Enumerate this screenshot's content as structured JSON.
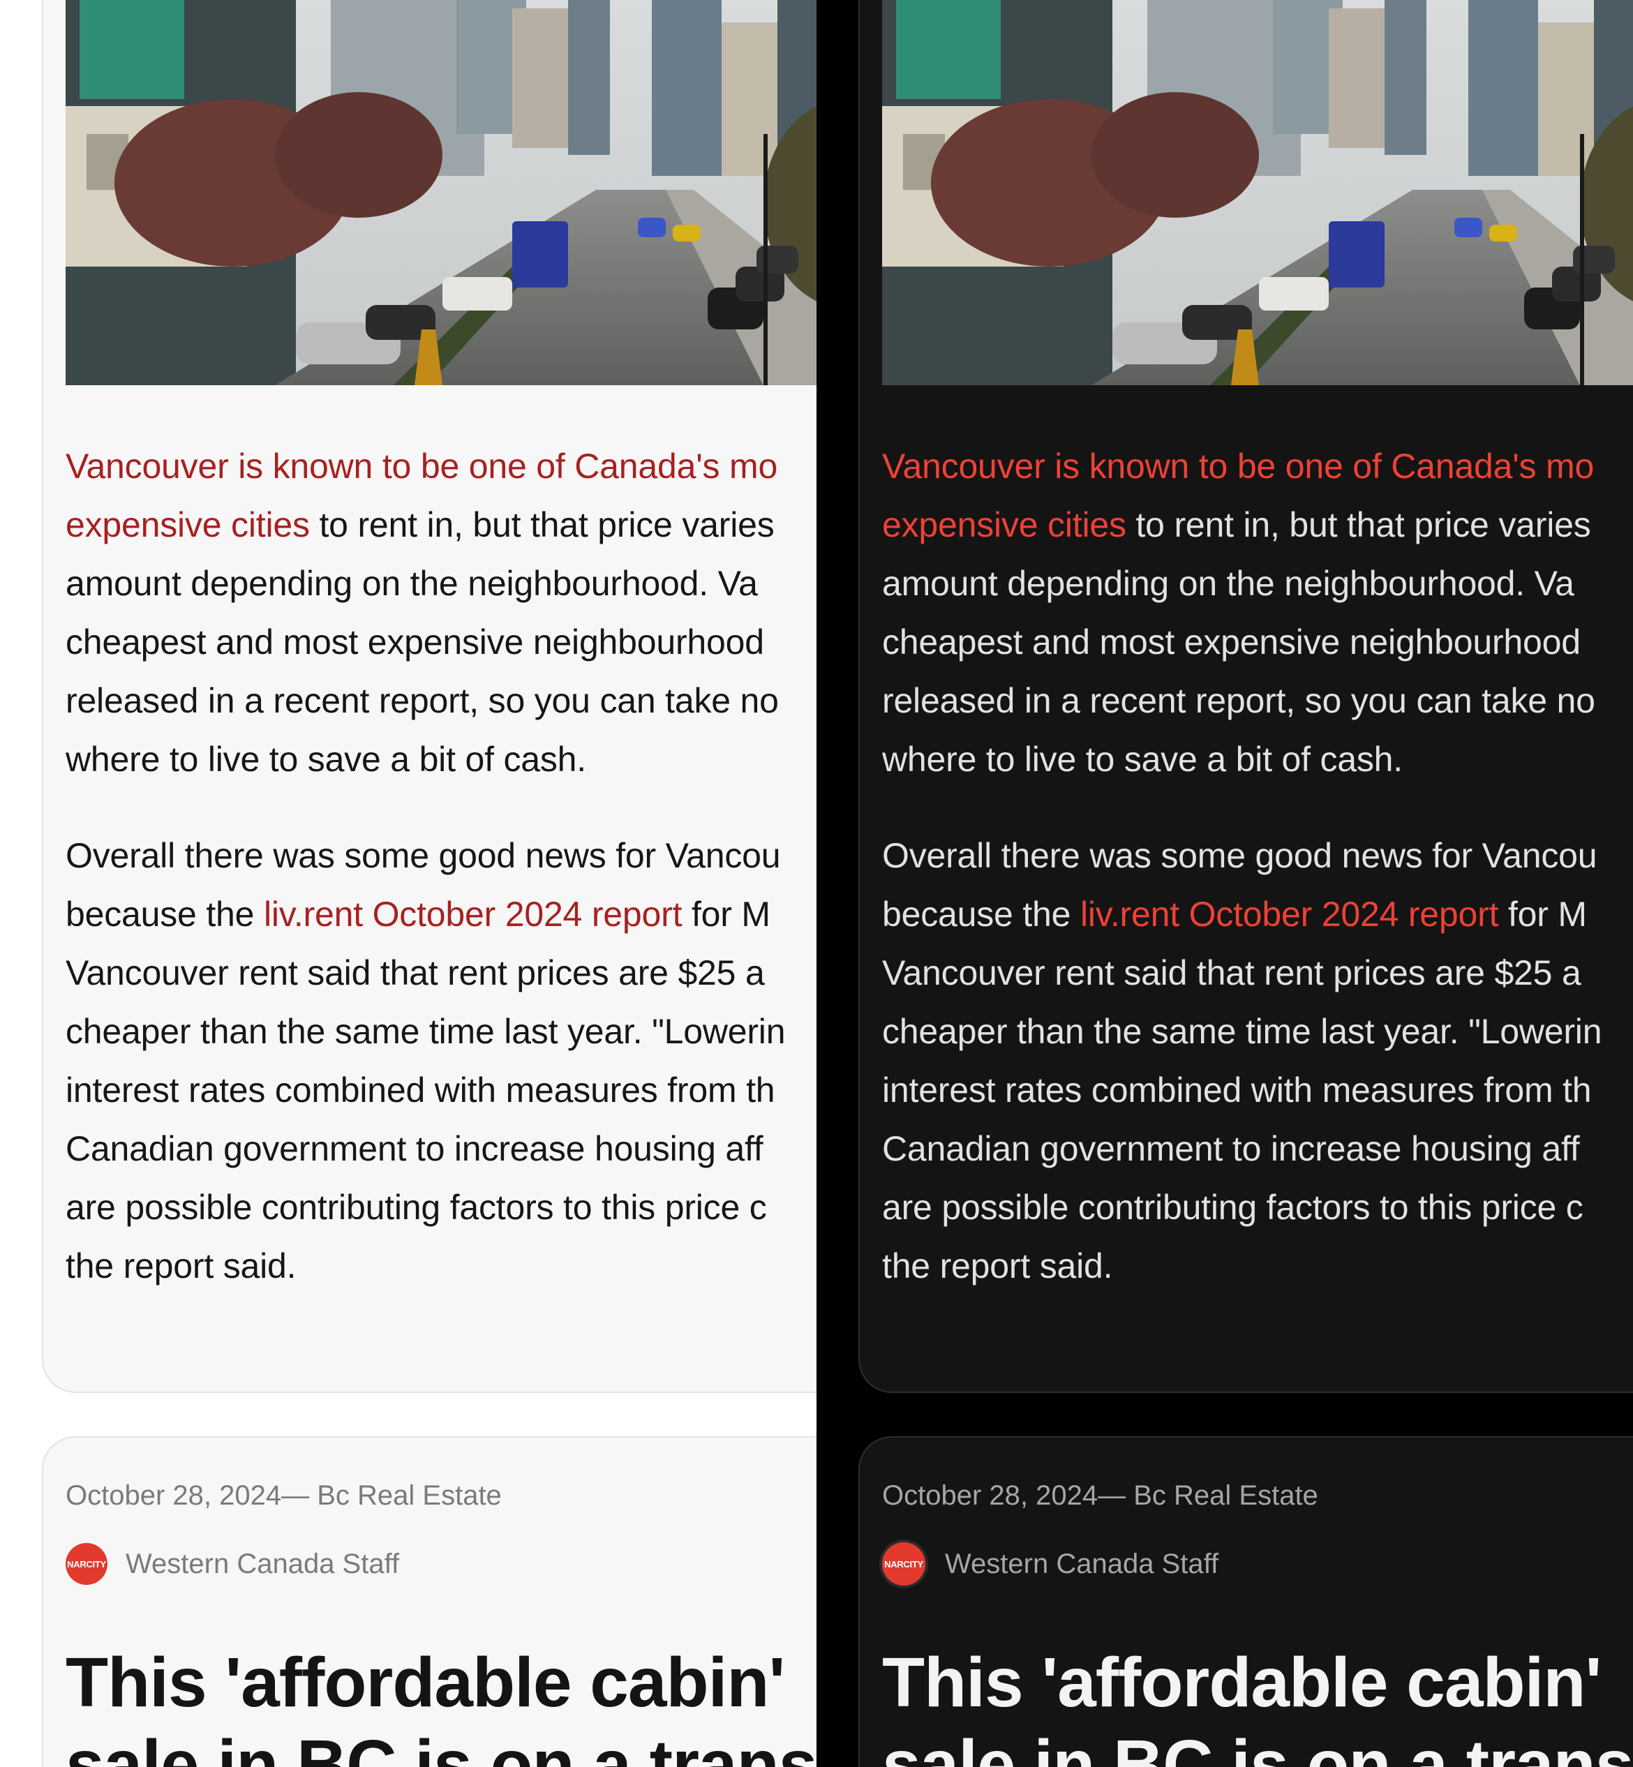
{
  "article_card": {
    "paragraph1": {
      "link_text_line1": "Vancouver is known to be one of Canada's mo",
      "link_text_line2": "expensive cities",
      "line2_rest": " to rent in, but that price varies",
      "line3": "amount depending on the neighbourhood. Va",
      "line4": "cheapest and most expensive neighbourhood",
      "line5": "released in a recent report, so you can take no",
      "line6": "where to live to save a bit of cash."
    },
    "paragraph2": {
      "line1": "Overall there was some good news for Vancou",
      "line2_before": "because the ",
      "line2_link": "liv.rent October 2024 report",
      "line2_after": " for M",
      "line3": "Vancouver rent said that rent prices are $25 a",
      "line4": "cheaper than the same time last year. \"Lowerin",
      "line5": "interest rates combined with measures from th",
      "line6": "Canadian government to increase housing aff",
      "line7": "are possible contributing factors to this price c",
      "line8": "the report said."
    }
  },
  "next_card": {
    "date": "October 28, 2024",
    "separator": "—",
    "category": "Bc Real Estate",
    "avatar_text": "NARCITY",
    "author": "Western Canada Staff",
    "headline_line1": "This 'affordable cabin'",
    "headline_line2": "sale in BC is on a trans"
  },
  "colors": {
    "light_link": "#a82020",
    "dark_link": "#ef4136",
    "avatar_bg": "#e23b2e"
  }
}
